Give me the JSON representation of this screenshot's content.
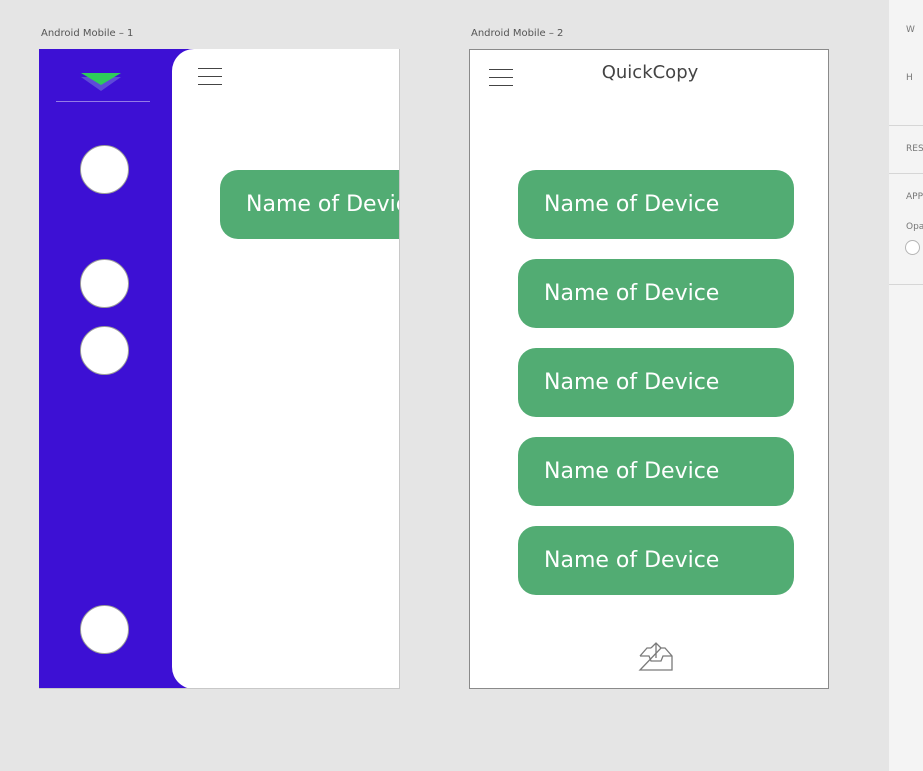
{
  "artboards": [
    {
      "label": "Android Mobile – 1"
    },
    {
      "label": "Android Mobile – 2"
    }
  ],
  "app": {
    "title": "QuickCopy"
  },
  "devices": [
    "Name of Device",
    "Name of Device",
    "Name of Device",
    "Name of Device",
    "Name of Device"
  ],
  "drawer_device": "Name of Device",
  "properties_panel": {
    "w_label": "W",
    "h_label": "H",
    "responsive_label": "RES",
    "appearance_label": "APP",
    "opacity_label": "Opa"
  },
  "colors": {
    "drawer": "#3d10d4",
    "button": "#52ac73",
    "logo_top": "#2ecc5a",
    "logo_bottom": "#5e4ad8",
    "canvas": "#e5e5e5"
  },
  "icons": {
    "menu": "hamburger-icon",
    "upload": "inbox-upload-icon",
    "logo": "chevron-down-logo-icon"
  }
}
